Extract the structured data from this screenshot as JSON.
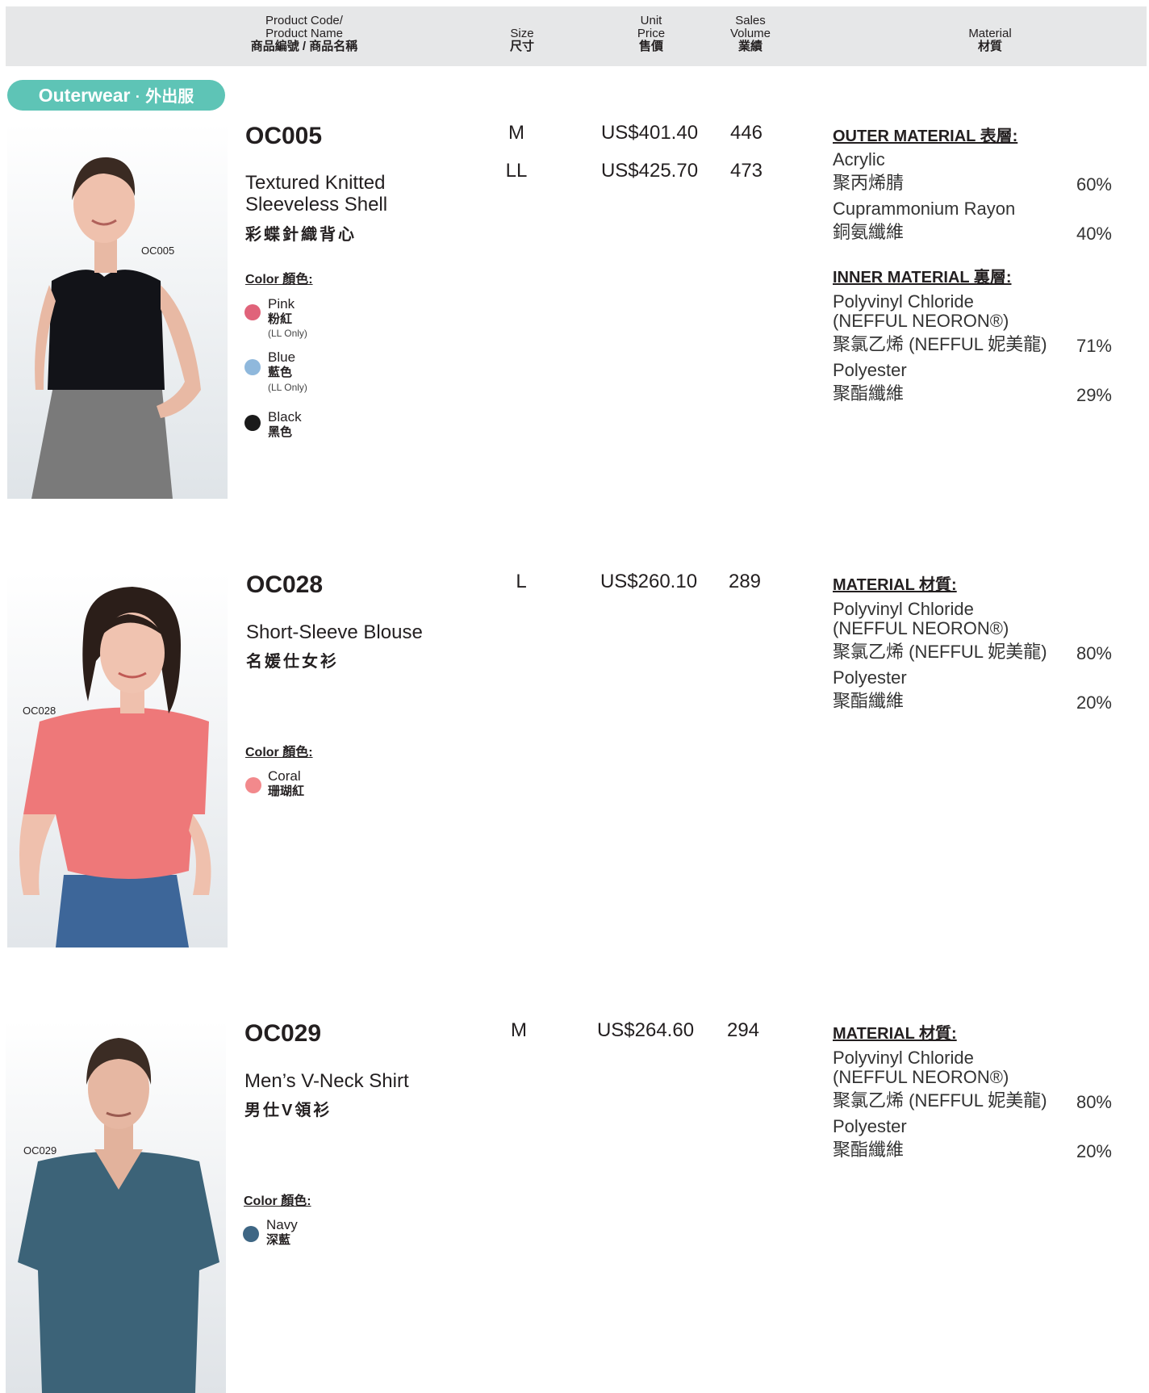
{
  "header": {
    "code_en_1": "Product Code/",
    "code_en_2": "Product Name",
    "code_zh": "商品編號 / 商品名稱",
    "size_en": "Size",
    "size_zh": "尺寸",
    "price_en_1": "Unit",
    "price_en_2": "Price",
    "price_zh": "售價",
    "sales_en_1": "Sales",
    "sales_en_2": "Volume",
    "sales_zh": "業績",
    "material_en": "Material",
    "material_zh": "材質"
  },
  "category": {
    "en": "Outerwear",
    "sep": "·",
    "zh": "外出服",
    "color": "#5ec4b6"
  },
  "products": [
    {
      "photo_label": "OC005",
      "code": "OC005",
      "name_en_1": "Textured Knitted",
      "name_en_2": "Sleeveless Shell",
      "name_zh": "彩蝶針織背心",
      "color_heading": "Color 顏色:",
      "colors": [
        {
          "en": "Pink",
          "zh": "粉紅",
          "note": "(LL Only)",
          "hex": "#e0637a"
        },
        {
          "en": "Blue",
          "zh": "藍色",
          "note": "(LL Only)",
          "hex": "#8fb8dc"
        },
        {
          "en": "Black",
          "zh": "黑色",
          "note": "",
          "hex": "#1a1a1a"
        }
      ],
      "rows": [
        {
          "size": "M",
          "price": "US$401.40",
          "sales": "446"
        },
        {
          "size": "LL",
          "price": "US$425.70",
          "sales": "473"
        }
      ],
      "materials": [
        {
          "heading": "OUTER MATERIAL  表層:",
          "items": [
            {
              "en": "Acrylic",
              "en2": "",
              "zh": "聚丙烯腈",
              "pct": "60%"
            },
            {
              "en": "Cuprammonium Rayon",
              "en2": "",
              "zh": "銅氨纖維",
              "pct": "40%"
            }
          ]
        },
        {
          "heading": "INNER MATERIAL  裏層:",
          "items": [
            {
              "en": "Polyvinyl Chloride",
              "en2": "(NEFFUL NEORON®)",
              "zh": "聚氯乙烯 (NEFFUL 妮美龍)",
              "pct": "71%"
            },
            {
              "en": "Polyester",
              "en2": "",
              "zh": "聚酯纖維",
              "pct": "29%"
            }
          ]
        }
      ]
    },
    {
      "photo_label": "OC028",
      "code": "OC028",
      "name_en_1": "Short-Sleeve Blouse",
      "name_en_2": "",
      "name_zh": "名媛仕女衫",
      "color_heading": "Color 顏色:",
      "colors": [
        {
          "en": "Coral",
          "zh": "珊瑚紅",
          "note": "",
          "hex": "#f2898c"
        }
      ],
      "rows": [
        {
          "size": "L",
          "price": "US$260.10",
          "sales": "289"
        }
      ],
      "materials": [
        {
          "heading": "MATERIAL  材質:",
          "items": [
            {
              "en": "Polyvinyl Chloride",
              "en2": "(NEFFUL NEORON®)",
              "zh": "聚氯乙烯 (NEFFUL 妮美龍)",
              "pct": "80%"
            },
            {
              "en": "Polyester",
              "en2": "",
              "zh": "聚酯纖維",
              "pct": "20%"
            }
          ]
        }
      ]
    },
    {
      "photo_label": "OC029",
      "code": "OC029",
      "name_en_1": "Men’s V-Neck Shirt",
      "name_en_2": "",
      "name_zh": "男仕V領衫",
      "color_heading": "Color 顏色:",
      "colors": [
        {
          "en": "Navy",
          "zh": "深藍",
          "note": "",
          "hex": "#3e6684"
        }
      ],
      "rows": [
        {
          "size": "M",
          "price": "US$264.60",
          "sales": "294"
        }
      ],
      "materials": [
        {
          "heading": "MATERIAL  材質:",
          "items": [
            {
              "en": "Polyvinyl Chloride",
              "en2": "(NEFFUL NEORON®)",
              "zh": "聚氯乙烯 (NEFFUL 妮美龍)",
              "pct": "80%"
            },
            {
              "en": "Polyester",
              "en2": "",
              "zh": "聚酯纖維",
              "pct": "20%"
            }
          ]
        }
      ]
    }
  ]
}
